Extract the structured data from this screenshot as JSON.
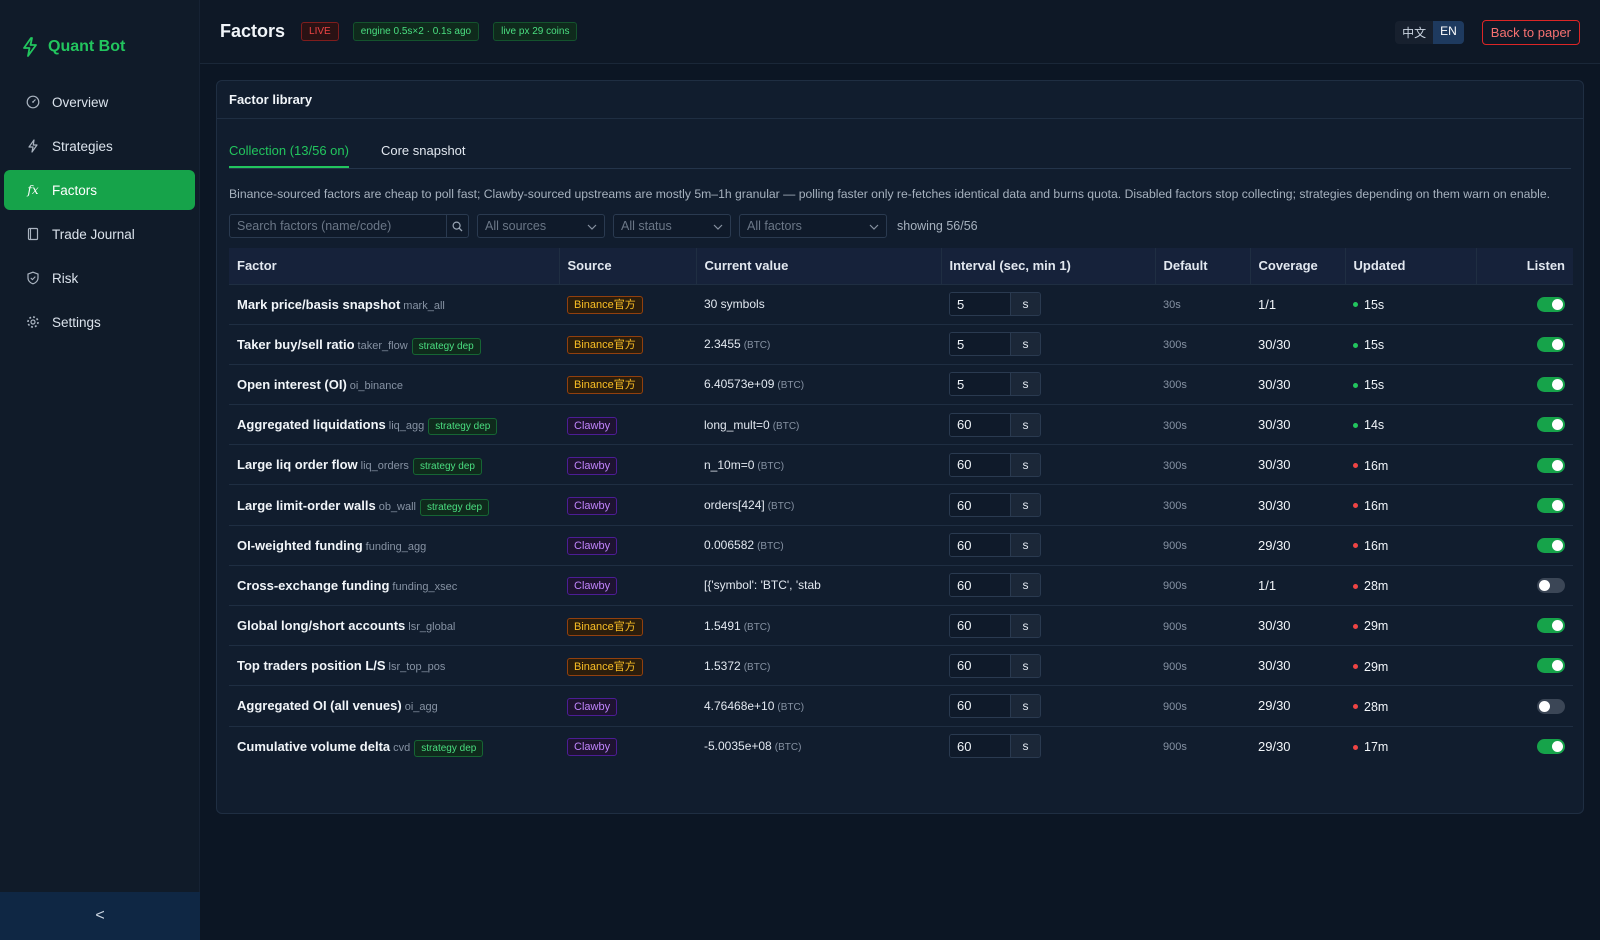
{
  "brand": {
    "title": "Quant Bot",
    "icon": "lightning-icon"
  },
  "sidebar": {
    "items": [
      {
        "label": "Overview",
        "icon": "dashboard-icon",
        "active": false
      },
      {
        "label": "Strategies",
        "icon": "bolt-icon",
        "active": false
      },
      {
        "label": "Factors",
        "icon": "fx-icon",
        "active": true
      },
      {
        "label": "Trade Journal",
        "icon": "journal-icon",
        "active": false
      },
      {
        "label": "Risk",
        "icon": "shield-icon",
        "active": false
      },
      {
        "label": "Settings",
        "icon": "gear-icon",
        "active": false
      }
    ],
    "collapse_glyph": "<"
  },
  "header": {
    "title": "Factors",
    "live_badge": "LIVE",
    "engine_badge": "engine 0.5s×2 · 0.1s ago",
    "px_badge": "live px 29 coins",
    "lang_zh": "中文",
    "lang_en": "EN",
    "back_label": "Back to paper"
  },
  "panel": {
    "title": "Factor library",
    "tabs": [
      {
        "label": "Collection (13/56 on)",
        "active": true
      },
      {
        "label": "Core snapshot",
        "active": false
      }
    ],
    "description": "Binance-sourced factors are cheap to poll fast; Clawby-sourced upstreams are mostly 5m–1h granular — polling faster only re-fetches identical data and burns quota. Disabled factors stop collecting; strategies depending on them warn on enable.",
    "search_placeholder": "Search factors (name/code)",
    "filter_sources": "All sources",
    "filter_status": "All status",
    "filter_factors": "All factors",
    "showing": "showing 56/56"
  },
  "table": {
    "columns": [
      "Factor",
      "Source",
      "Current value",
      "Interval (sec, min 1)",
      "Default",
      "Coverage",
      "Updated",
      "Listen"
    ],
    "dep_label": "strategy dep",
    "interval_suffix": "s",
    "rows": [
      {
        "name": "Mark price/basis snapshot",
        "code": "mark_all",
        "dep": false,
        "source": "Binance官方",
        "source_kind": "binance",
        "value": "30 symbols",
        "unit": "",
        "interval": "5",
        "default": "30s",
        "coverage": "1/1",
        "updated": "15s",
        "fresh": true,
        "listen": true
      },
      {
        "name": "Taker buy/sell ratio",
        "code": "taker_flow",
        "dep": true,
        "source": "Binance官方",
        "source_kind": "binance",
        "value": "2.3455",
        "unit": "(BTC)",
        "interval": "5",
        "default": "300s",
        "coverage": "30/30",
        "updated": "15s",
        "fresh": true,
        "listen": true
      },
      {
        "name": "Open interest (OI)",
        "code": "oi_binance",
        "dep": false,
        "source": "Binance官方",
        "source_kind": "binance",
        "value": "6.40573e+09",
        "unit": "(BTC)",
        "interval": "5",
        "default": "300s",
        "coverage": "30/30",
        "updated": "15s",
        "fresh": true,
        "listen": true
      },
      {
        "name": "Aggregated liquidations",
        "code": "liq_agg",
        "dep": true,
        "source": "Clawby",
        "source_kind": "clawby",
        "value": "long_mult=0",
        "unit": "(BTC)",
        "interval": "60",
        "default": "300s",
        "coverage": "30/30",
        "updated": "14s",
        "fresh": true,
        "listen": true
      },
      {
        "name": "Large liq order flow",
        "code": "liq_orders",
        "dep": true,
        "source": "Clawby",
        "source_kind": "clawby",
        "value": "n_10m=0",
        "unit": "(BTC)",
        "interval": "60",
        "default": "300s",
        "coverage": "30/30",
        "updated": "16m",
        "fresh": false,
        "listen": true
      },
      {
        "name": "Large limit-order walls",
        "code": "ob_wall",
        "dep": true,
        "source": "Clawby",
        "source_kind": "clawby",
        "value": "orders[424]",
        "unit": "(BTC)",
        "interval": "60",
        "default": "300s",
        "coverage": "30/30",
        "updated": "16m",
        "fresh": false,
        "listen": true
      },
      {
        "name": "OI-weighted funding",
        "code": "funding_agg",
        "dep": false,
        "source": "Clawby",
        "source_kind": "clawby",
        "value": "0.006582",
        "unit": "(BTC)",
        "interval": "60",
        "default": "900s",
        "coverage": "29/30",
        "updated": "16m",
        "fresh": false,
        "listen": true
      },
      {
        "name": "Cross-exchange funding",
        "code": "funding_xsec",
        "dep": false,
        "source": "Clawby",
        "source_kind": "clawby",
        "value": "[{'symbol': 'BTC', 'stab",
        "unit": "",
        "interval": "60",
        "default": "900s",
        "coverage": "1/1",
        "updated": "28m",
        "fresh": false,
        "listen": false
      },
      {
        "name": "Global long/short accounts",
        "code": "lsr_global",
        "dep": false,
        "source": "Binance官方",
        "source_kind": "binance",
        "value": "1.5491",
        "unit": "(BTC)",
        "interval": "60",
        "default": "900s",
        "coverage": "30/30",
        "updated": "29m",
        "fresh": false,
        "listen": true
      },
      {
        "name": "Top traders position L/S",
        "code": "lsr_top_pos",
        "dep": false,
        "source": "Binance官方",
        "source_kind": "binance",
        "value": "1.5372",
        "unit": "(BTC)",
        "interval": "60",
        "default": "900s",
        "coverage": "30/30",
        "updated": "29m",
        "fresh": false,
        "listen": true
      },
      {
        "name": "Aggregated OI (all venues)",
        "code": "oi_agg",
        "dep": false,
        "source": "Clawby",
        "source_kind": "clawby",
        "value": "4.76468e+10",
        "unit": "(BTC)",
        "interval": "60",
        "default": "900s",
        "coverage": "29/30",
        "updated": "28m",
        "fresh": false,
        "listen": false
      },
      {
        "name": "Cumulative volume delta",
        "code": "cvd",
        "dep": true,
        "source": "Clawby",
        "source_kind": "clawby",
        "value": "-5.0035e+08",
        "unit": "(BTC)",
        "interval": "60",
        "default": "900s",
        "coverage": "29/30",
        "updated": "17m",
        "fresh": false,
        "listen": true
      }
    ]
  },
  "colors": {
    "accent": "#22c55e",
    "background": "#0c1624",
    "panel": "#111d2e",
    "live_red": "#ef4444",
    "binance_amber": "#fbbf24",
    "clawby_purple": "#c084fc"
  }
}
